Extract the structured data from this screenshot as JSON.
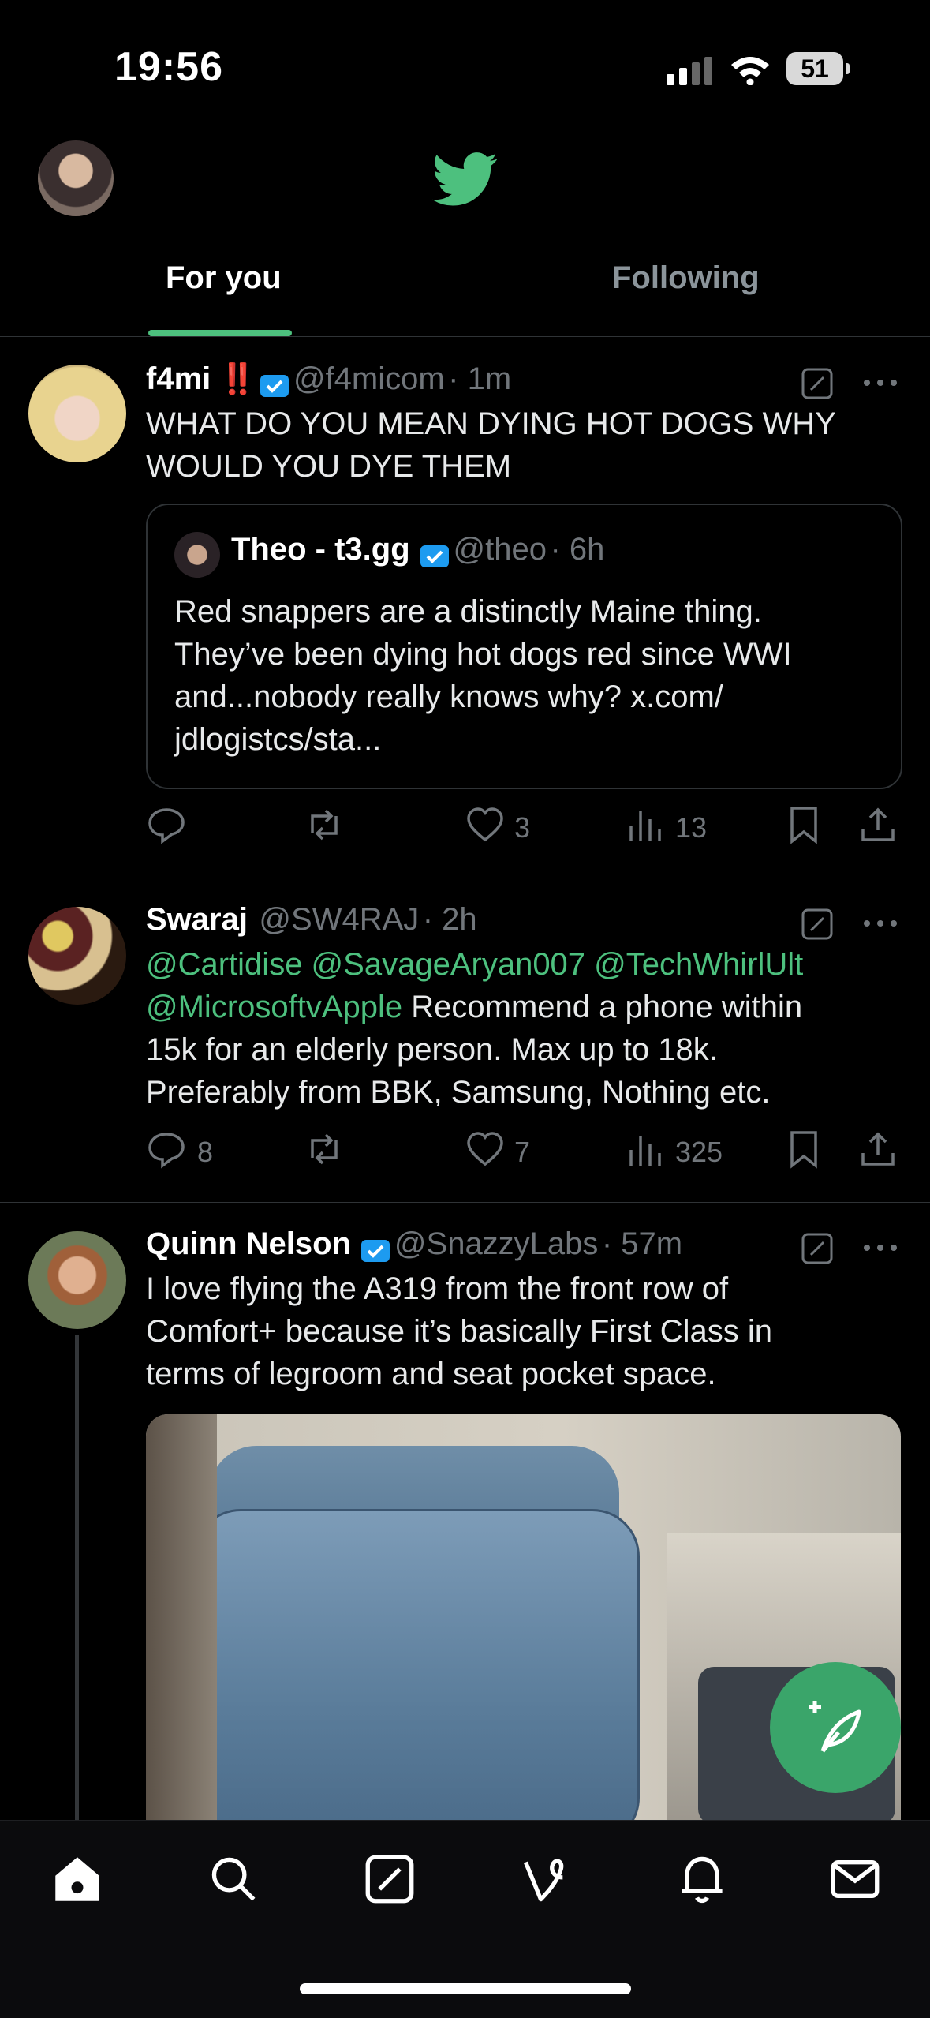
{
  "status_bar": {
    "time": "19:56",
    "battery": "51"
  },
  "header": {
    "tabs": [
      {
        "label": "For you"
      },
      {
        "label": "Following"
      }
    ]
  },
  "tweets": [
    {
      "name": "f4mi",
      "name_emoji": "‼️",
      "handle": "@f4micom",
      "time": "· 1m",
      "lines": [
        "WHAT DO YOU MEAN DYING HOT DOGS WHY",
        "WOULD YOU DYE THEM"
      ],
      "quote": {
        "name": "Theo - t3.gg",
        "handle": "@theo",
        "time": "· 6h",
        "lines": [
          "Red snappers are a distinctly Maine thing.",
          "They’ve been dying hot dogs red since WWI",
          "and...nobody really knows why? x.com/",
          "jdlogistcs/sta..."
        ]
      },
      "likes": "3",
      "views": "13"
    },
    {
      "name": "Swaraj",
      "handle": "@SW4RAJ",
      "time": "· 2h",
      "line1_mentions": "@Cartidise @SavageAryan007 @TechWhirlUlt",
      "line2_mention": "@MicrosoftvApple",
      "line2_text": " Recommend a phone within",
      "lines_rest": [
        "15k for an elderly person. Max up to 18k.",
        "Preferably from BBK, Samsung, Nothing etc."
      ],
      "replies": "8",
      "likes": "7",
      "views": "325"
    },
    {
      "name": "Quinn Nelson",
      "handle": "@SnazzyLabs",
      "time": "· 57m",
      "lines": [
        "I love flying the A319 from the front row of",
        "Comfort+ because it’s basically First Class in",
        "terms of legroom and seat pocket space."
      ]
    }
  ],
  "bottom_nav": [
    "home-icon",
    "search-icon",
    "compose-icon",
    "vine-icon",
    "bell-icon",
    "mail-icon"
  ],
  "colors": {
    "accent": "#4dc07e",
    "verified": "#1d9bf0",
    "background": "#000000",
    "muted": "#71767b"
  }
}
